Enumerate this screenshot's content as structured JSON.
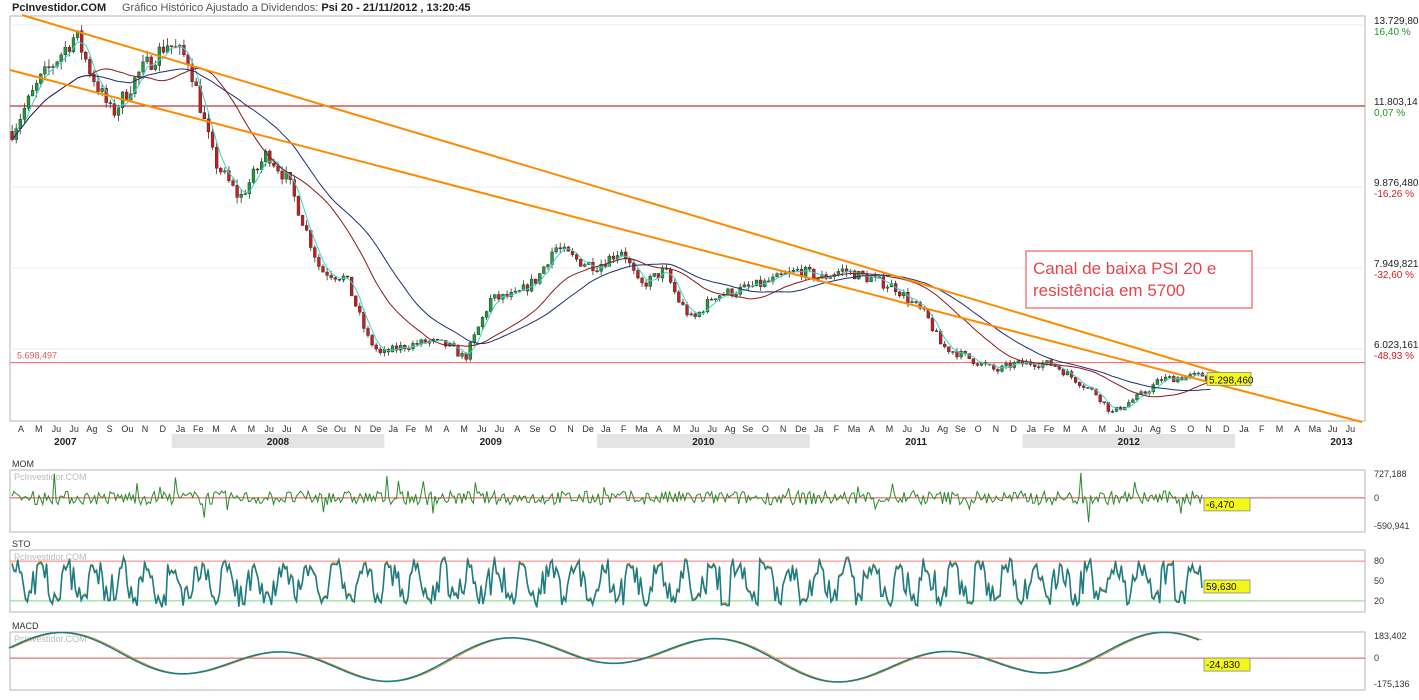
{
  "header": {
    "brand": "PcInvestidor.COM",
    "subtitle": "Gráfico Histórico Ajustado a Dividendos: ",
    "instrument": "Psi 20 - 21/11/2012 , 13:20:45"
  },
  "colors": {
    "up": "#1f9e3c",
    "down": "#c81e1e",
    "channel": "#ff8a00",
    "ma_fast": "#40d4c4",
    "ma_mid": "#8b1a1a",
    "ma_slow": "#1b2f6e",
    "hline": "#d40000",
    "badge": "#f3f71a"
  },
  "chart_data": [
    {
      "type": "line",
      "name": "price",
      "y_levels": [
        {
          "value": "13.729,80",
          "pct": "16,40 %"
        },
        {
          "value": "11.803,14",
          "pct": "0,07 %"
        },
        {
          "value": "9.876,480",
          "pct": "-16,26 %"
        },
        {
          "value": "7.949,821",
          "pct": "-32,60 %"
        },
        {
          "value": "6.023,161",
          "pct": "-48,93 %"
        }
      ],
      "support_level": "5.698,497",
      "last_value": "5.298,460",
      "months": [
        "A",
        "M",
        "Ju",
        "Ju",
        "Ag",
        "S",
        "Ou",
        "N",
        "D",
        "Ja",
        "Fe",
        "M",
        "A",
        "M",
        "Ju",
        "Ju",
        "A",
        "Se",
        "Ou",
        "N",
        "De",
        "Ja",
        "Fe",
        "M",
        "A",
        "M",
        "Ju",
        "Ju",
        "A",
        "Se",
        "O",
        "N",
        "De",
        "Ja",
        "F",
        "Ma",
        "A",
        "M",
        "Ju",
        "Ju",
        "Ag",
        "Se",
        "O",
        "N",
        "De",
        "Ja",
        "F",
        "Ma",
        "A",
        "M",
        "Ju",
        "Ju",
        "Ag",
        "Se",
        "O",
        "N",
        "D",
        "Ja",
        "Fe",
        "M",
        "A",
        "M",
        "Ju",
        "Ju",
        "Ag",
        "S",
        "O",
        "N",
        "D",
        "Ja",
        "F",
        "M",
        "A",
        "Ma",
        "Ju",
        "Ju",
        "A",
        "S"
      ],
      "years": [
        "2007",
        "2008",
        "2009",
        "2010",
        "2011",
        "2012",
        "2013"
      ],
      "annotation": "Canal de baixa PSI 20 e\nresistência em 5700",
      "waypoints": [
        [
          2007.25,
          11200
        ],
        [
          2007.38,
          12400
        ],
        [
          2007.55,
          13500
        ],
        [
          2007.62,
          12600
        ],
        [
          2007.72,
          11600
        ],
        [
          2007.85,
          12600
        ],
        [
          2007.98,
          13300
        ],
        [
          2008.08,
          12900
        ],
        [
          2008.2,
          10500
        ],
        [
          2008.32,
          9600
        ],
        [
          2008.45,
          10700
        ],
        [
          2008.55,
          10000
        ],
        [
          2008.7,
          7900
        ],
        [
          2008.82,
          7700
        ],
        [
          2008.92,
          6300
        ],
        [
          2008.98,
          5900
        ],
        [
          2009.1,
          6100
        ],
        [
          2009.22,
          6200
        ],
        [
          2009.3,
          6100
        ],
        [
          2009.38,
          5800
        ],
        [
          2009.5,
          7200
        ],
        [
          2009.62,
          7300
        ],
        [
          2009.72,
          7700
        ],
        [
          2009.8,
          8450
        ],
        [
          2009.92,
          8100
        ],
        [
          2010.0,
          8000
        ],
        [
          2010.12,
          8400
        ],
        [
          2010.2,
          7500
        ],
        [
          2010.32,
          7900
        ],
        [
          2010.38,
          7200
        ],
        [
          2010.45,
          6700
        ],
        [
          2010.55,
          7300
        ],
        [
          2010.65,
          7400
        ],
        [
          2010.8,
          7600
        ],
        [
          2010.95,
          7900
        ],
        [
          2011.05,
          7700
        ],
        [
          2011.15,
          7900
        ],
        [
          2011.22,
          7800
        ],
        [
          2011.4,
          7500
        ],
        [
          2011.55,
          6800
        ],
        [
          2011.62,
          6100
        ],
        [
          2011.75,
          5800
        ],
        [
          2011.88,
          5500
        ],
        [
          2011.95,
          5650
        ],
        [
          2012.05,
          5700
        ],
        [
          2012.15,
          5650
        ],
        [
          2012.22,
          5400
        ],
        [
          2012.35,
          4950
        ],
        [
          2012.42,
          4500
        ],
        [
          2012.5,
          4750
        ],
        [
          2012.58,
          5000
        ],
        [
          2012.65,
          5300
        ],
        [
          2012.75,
          5350
        ],
        [
          2012.85,
          5400
        ],
        [
          2012.89,
          5298
        ]
      ]
    },
    {
      "type": "line",
      "name": "MOM",
      "y_labels": [
        "727,188",
        "0",
        "-590,941"
      ],
      "last_value": "-6,470"
    },
    {
      "type": "line",
      "name": "STO",
      "y_labels": [
        "80",
        "50",
        "20"
      ],
      "last_value": "59,630"
    },
    {
      "type": "line",
      "name": "MACD",
      "y_labels": [
        "183,402",
        "0",
        "-175,136"
      ],
      "last_value": "-24,830"
    }
  ],
  "watermark": "PcInvestidor.COM"
}
